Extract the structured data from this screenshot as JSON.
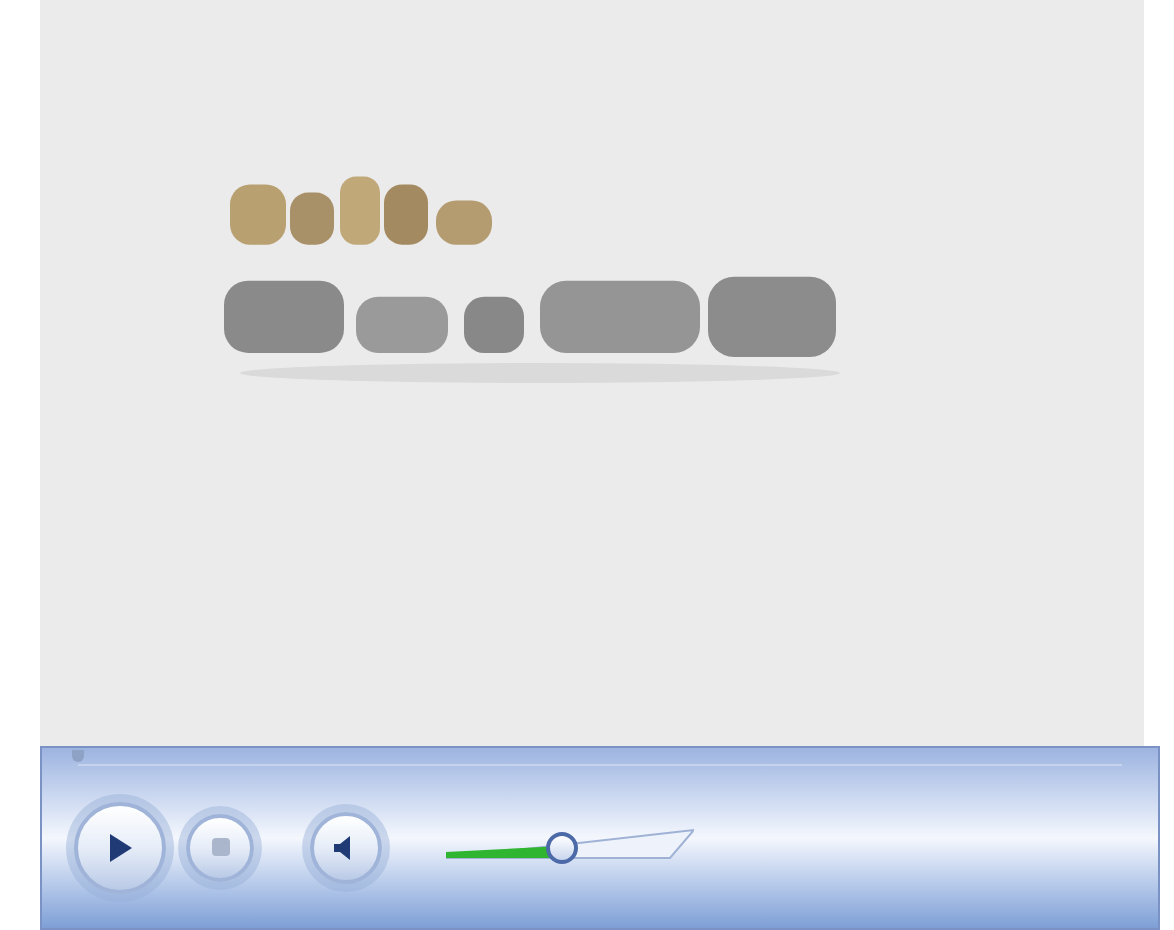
{
  "player": {
    "seek": {
      "level": 0
    },
    "volume": {
      "level": 0.47
    }
  }
}
